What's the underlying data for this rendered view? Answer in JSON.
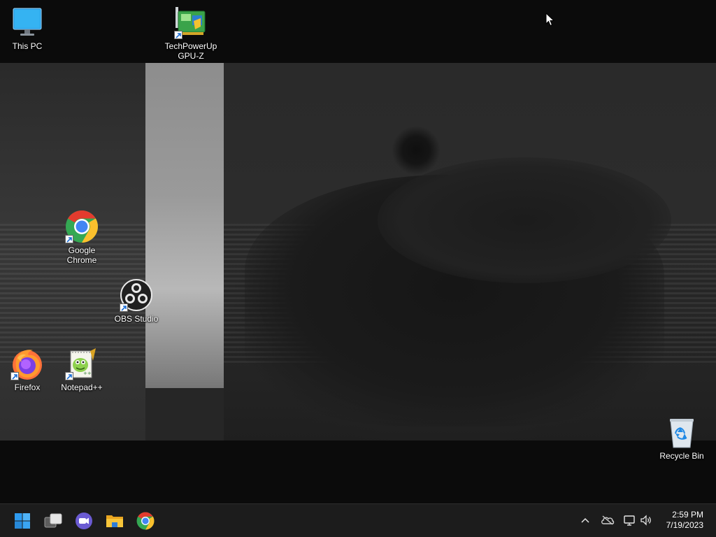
{
  "desktop": {
    "icons": [
      {
        "label": "This PC",
        "icon": "this-pc-icon"
      },
      {
        "label": "TechPowerUp\nGPU-Z",
        "icon": "gpu-z-icon"
      },
      {
        "label": "Google\nChrome",
        "icon": "chrome-icon"
      },
      {
        "label": "OBS Studio",
        "icon": "obs-icon"
      },
      {
        "label": "Firefox",
        "icon": "firefox-icon"
      },
      {
        "label": "Notepad++",
        "icon": "notepad-plus-plus-icon"
      },
      {
        "label": "Recycle Bin",
        "icon": "recycle-bin-icon"
      }
    ]
  },
  "taskbar": {
    "pinned": [
      {
        "name": "Start",
        "icon": "windows-start-icon"
      },
      {
        "name": "Task View",
        "icon": "task-view-icon"
      },
      {
        "name": "Chat",
        "icon": "teams-chat-icon"
      },
      {
        "name": "File Explorer",
        "icon": "file-explorer-icon"
      },
      {
        "name": "Google Chrome",
        "icon": "chrome-icon"
      }
    ],
    "tray": {
      "icons": [
        "chevron-up-icon",
        "onedrive-icon",
        "network-icon",
        "volume-icon"
      ]
    },
    "clock": {
      "time": "2:59 PM",
      "date": "7/19/2023"
    }
  },
  "colors": {
    "taskbar_bg": "#1c1c1c",
    "windows_blue": "#2e9bf0",
    "chrome_red": "#e33b2e",
    "chrome_yellow": "#fbc02d",
    "chrome_green": "#34a853",
    "chrome_blue": "#4285f4"
  }
}
